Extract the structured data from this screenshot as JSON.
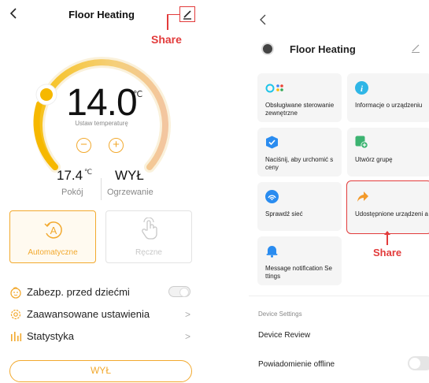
{
  "left": {
    "title": "Floor Heating",
    "share_annotation": "Share",
    "target_temp": "14.0",
    "temp_unit": "℃",
    "set_label": "Ustaw temperaturę",
    "minus": "−",
    "plus": "+",
    "room_temp": "17.4",
    "room_unit": "℃",
    "room_label": "Pokój",
    "heating_state": "WYŁ",
    "heating_label": "Ogrzewanie",
    "mode_auto": "Automatyczne",
    "mode_manual": "Ręczne",
    "rows": [
      {
        "label": "Zabezp. przed dziećmi"
      },
      {
        "label": "Zaawansowane ustawienia",
        "chevron": ">"
      },
      {
        "label": "Statystyka",
        "chevron": ">"
      }
    ],
    "off_button": "WYŁ"
  },
  "right": {
    "title": "Floor Heating",
    "tiles": [
      {
        "label": "Obsługiwane sterowanie zewnętrzne",
        "icon": "voice-assistants-icon"
      },
      {
        "label": "Informacje o urządzeniu",
        "icon": "info-icon"
      },
      {
        "label": "Naciśnij, aby urchomić s ceny",
        "icon": "tap-to-run-icon"
      },
      {
        "label": "Utwórz grupę",
        "icon": "create-group-icon"
      },
      {
        "label": "Sprawdź sieć",
        "icon": "network-check-icon"
      },
      {
        "label": "Udostępnione urządzeni a",
        "icon": "share-arrow-icon"
      },
      {
        "label": "Message notification Se ttings",
        "icon": "bell-icon"
      }
    ],
    "share_annotation": "Share",
    "section_label": "Device Settings",
    "device_review": "Device Review",
    "offline_notification": "Powiadomienie offline"
  },
  "colors": {
    "accent_orange": "#f2a92e",
    "annotation_red": "#e23b3b",
    "blue": "#2a8cf0",
    "green": "#3cb371"
  }
}
